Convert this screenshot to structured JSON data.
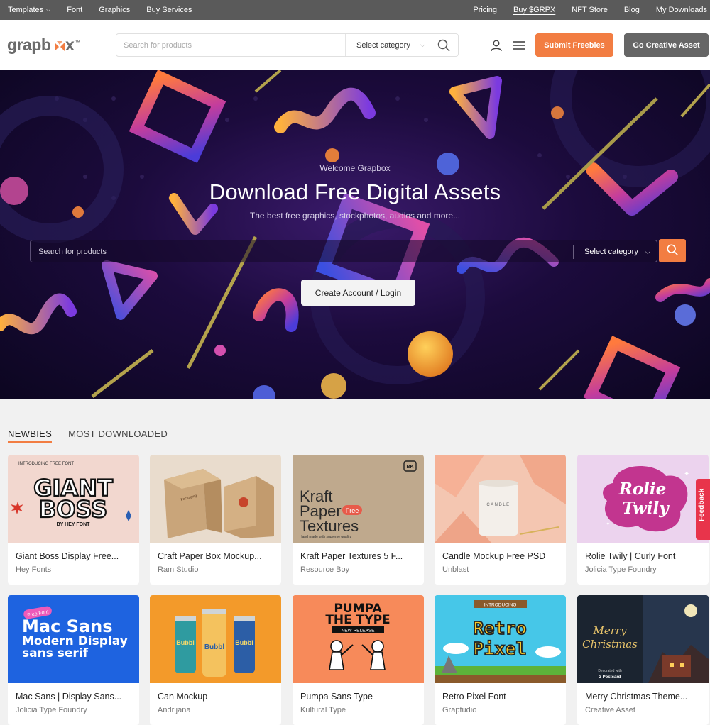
{
  "topbar": {
    "left": [
      "Templates",
      "Font",
      "Graphics",
      "Buy Services"
    ],
    "right": [
      "Pricing",
      "Buy $GRPX",
      "NFT Store",
      "Blog",
      "My Downloads"
    ]
  },
  "header": {
    "logo": "grapbox",
    "logo_tm": "™",
    "search_placeholder": "Search for products",
    "category_label": "Select category",
    "submit_label": "Submit Freebies",
    "go_label": "Go Creative Asset"
  },
  "hero": {
    "welcome": "Welcome Grapbox",
    "title": "Download Free Digital Assets",
    "subtitle": "The best free graphics, stockphotos, audios and more...",
    "search_placeholder": "Search for products",
    "category_label": "Select category",
    "create_label": "Create Account / Login"
  },
  "tabs": [
    "NEWBIES",
    "MOST DOWNLOADED"
  ],
  "cards": [
    {
      "title": "Giant Boss Display Free...",
      "author": "Hey Fonts"
    },
    {
      "title": "Craft Paper Box Mockup...",
      "author": "Ram Studio"
    },
    {
      "title": "Kraft Paper Textures 5 F...",
      "author": "Resource Boy"
    },
    {
      "title": "Candle Mockup Free PSD",
      "author": "Unblast"
    },
    {
      "title": "Rolie Twily | Curly Font",
      "author": "Jolicia Type Foundry"
    },
    {
      "title": "Mac Sans | Display Sans...",
      "author": "Jolicia Type Foundry"
    },
    {
      "title": "Can Mockup",
      "author": "Andrijana"
    },
    {
      "title": "Pumpa Sans Type",
      "author": "Kultural Type"
    },
    {
      "title": "Retro Pixel Font",
      "author": "Graptudio"
    },
    {
      "title": "Merry Christmas Theme...",
      "author": "Creative Asset"
    }
  ],
  "thumb_text": {
    "giant_top": "INTRODUCING FREE FONT",
    "giant_main1": "GIANT",
    "giant_main2": "BOSS",
    "giant_by": "BY HEY FONT",
    "kraft1": "Kraft",
    "kraft2": "Paper",
    "kraft_free": "Free",
    "kraft3": "Textures",
    "kraft_sub": "Hand made with supreme quality",
    "kraft_badge": "BK",
    "candle": "CANDLE",
    "rolie1": "Rolie",
    "rolie2": "Twily",
    "mac_tag": "Free Font",
    "mac1": "Mac Sans",
    "mac2": "Modern Display",
    "mac3": "sans serif",
    "can_label": "Bubbl",
    "pumpa1": "PUMPA",
    "pumpa2": "THE TYPE",
    "pumpa_tag": "NEW RELEASE",
    "retro_tag": "INTRODUCING",
    "retro1": "Retro",
    "retro2": "Pixel",
    "xmas1": "Merry",
    "xmas2": "Christmas",
    "xmas_note": "Decorated with",
    "xmas_count": "3 Postcard"
  },
  "feedback": "Feedback",
  "colors": {
    "accent": "#f27d42",
    "topbar": "#5a5a5a",
    "feedback": "#e8344b"
  }
}
